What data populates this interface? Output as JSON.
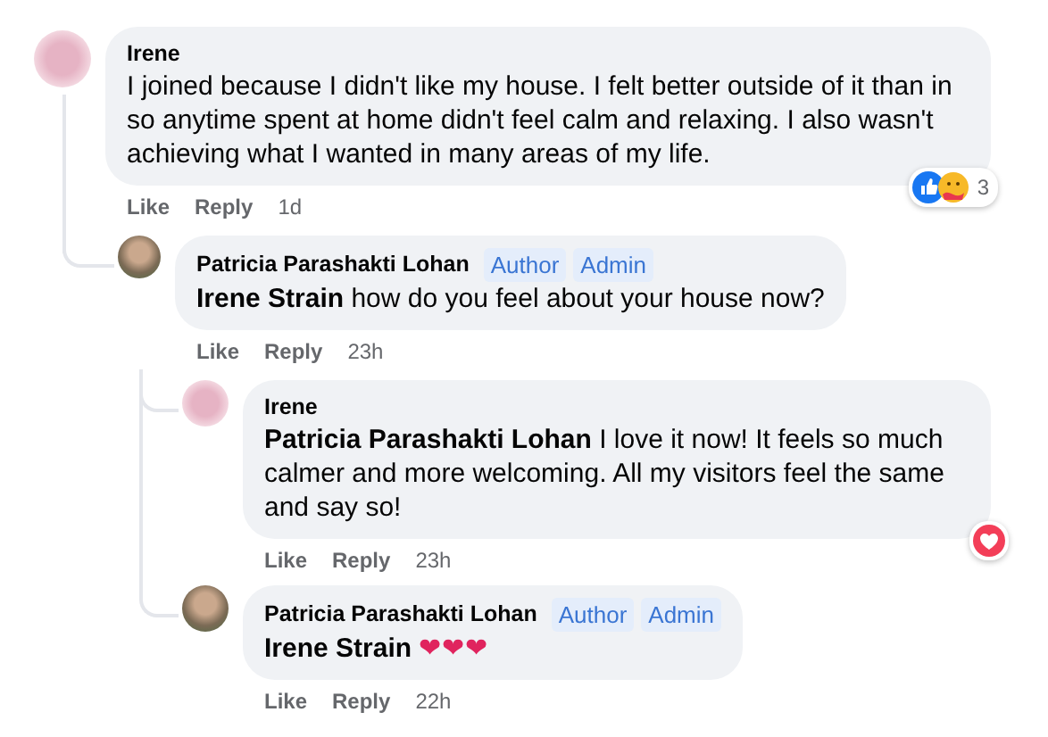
{
  "comments": [
    {
      "author": "Irene",
      "avatar_photo": false,
      "text": "I joined because I didn't like my house. I felt better outside of it than in so anytime spent at home didn't feel calm and relaxing. I also wasn't achieving what I wanted in many areas of my life.",
      "like": "Like",
      "reply": "Reply",
      "time": "1d",
      "reactions": [
        {
          "kind": "like"
        },
        {
          "kind": "care"
        }
      ],
      "reaction_count": "3",
      "replies": [
        {
          "author": "Patricia Parashakti Lohan",
          "avatar_photo": true,
          "badges": [
            "Author",
            "Admin"
          ],
          "text": "**Irene Strain** how do you feel about your house now?",
          "like": "Like",
          "reply": "Reply",
          "time": "23h",
          "replies": [
            {
              "author": "Irene",
              "avatar_photo": false,
              "text": "**Patricia Parashakti Lohan** I love it now! It feels so much calmer and more welcoming. All my visitors feel the same and say so!",
              "like": "Like",
              "reply": "Reply",
              "time": "23h",
              "reactions": [
                {
                  "kind": "love"
                }
              ]
            },
            {
              "author": "Patricia Parashakti Lohan",
              "avatar_photo": true,
              "badges": [
                "Author",
                "Admin"
              ],
              "text": "**Irene Strain**",
              "emoji": "❤❤❤",
              "like": "Like",
              "reply": "Reply",
              "time": "22h"
            }
          ]
        }
      ]
    }
  ]
}
